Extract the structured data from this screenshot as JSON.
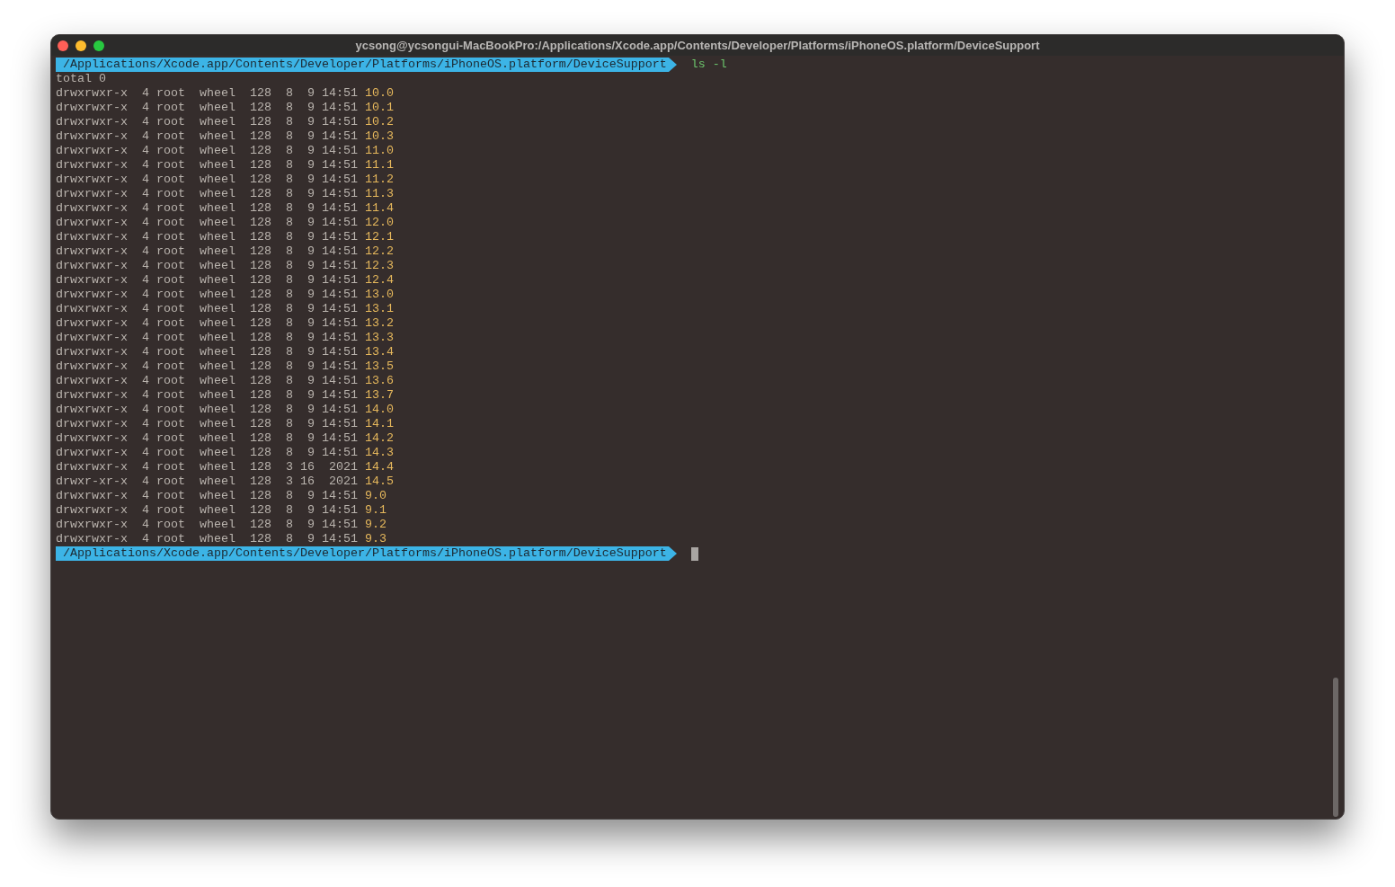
{
  "window": {
    "title": "ycsong@ycsongui-MacBookPro:/Applications/Xcode.app/Contents/Developer/Platforms/iPhoneOS.platform/DeviceSupport"
  },
  "terminal": {
    "lines": [
      {
        "kind": "prompt",
        "path": "/Applications/Xcode.app/Contents/Developer/Platforms/iPhoneOS.platform/DeviceSupport",
        "command": "ls -l"
      },
      {
        "kind": "text",
        "text": "total 0"
      },
      {
        "kind": "entry",
        "info": "drwxrwxr-x  4 root  wheel  128  8  9 14:51",
        "name": "10.0"
      },
      {
        "kind": "entry",
        "info": "drwxrwxr-x  4 root  wheel  128  8  9 14:51",
        "name": "10.1"
      },
      {
        "kind": "entry",
        "info": "drwxrwxr-x  4 root  wheel  128  8  9 14:51",
        "name": "10.2"
      },
      {
        "kind": "entry",
        "info": "drwxrwxr-x  4 root  wheel  128  8  9 14:51",
        "name": "10.3"
      },
      {
        "kind": "entry",
        "info": "drwxrwxr-x  4 root  wheel  128  8  9 14:51",
        "name": "11.0"
      },
      {
        "kind": "entry",
        "info": "drwxrwxr-x  4 root  wheel  128  8  9 14:51",
        "name": "11.1"
      },
      {
        "kind": "entry",
        "info": "drwxrwxr-x  4 root  wheel  128  8  9 14:51",
        "name": "11.2"
      },
      {
        "kind": "entry",
        "info": "drwxrwxr-x  4 root  wheel  128  8  9 14:51",
        "name": "11.3"
      },
      {
        "kind": "entry",
        "info": "drwxrwxr-x  4 root  wheel  128  8  9 14:51",
        "name": "11.4"
      },
      {
        "kind": "entry",
        "info": "drwxrwxr-x  4 root  wheel  128  8  9 14:51",
        "name": "12.0"
      },
      {
        "kind": "entry",
        "info": "drwxrwxr-x  4 root  wheel  128  8  9 14:51",
        "name": "12.1"
      },
      {
        "kind": "entry",
        "info": "drwxrwxr-x  4 root  wheel  128  8  9 14:51",
        "name": "12.2"
      },
      {
        "kind": "entry",
        "info": "drwxrwxr-x  4 root  wheel  128  8  9 14:51",
        "name": "12.3"
      },
      {
        "kind": "entry",
        "info": "drwxrwxr-x  4 root  wheel  128  8  9 14:51",
        "name": "12.4"
      },
      {
        "kind": "entry",
        "info": "drwxrwxr-x  4 root  wheel  128  8  9 14:51",
        "name": "13.0"
      },
      {
        "kind": "entry",
        "info": "drwxrwxr-x  4 root  wheel  128  8  9 14:51",
        "name": "13.1"
      },
      {
        "kind": "entry",
        "info": "drwxrwxr-x  4 root  wheel  128  8  9 14:51",
        "name": "13.2"
      },
      {
        "kind": "entry",
        "info": "drwxrwxr-x  4 root  wheel  128  8  9 14:51",
        "name": "13.3"
      },
      {
        "kind": "entry",
        "info": "drwxrwxr-x  4 root  wheel  128  8  9 14:51",
        "name": "13.4"
      },
      {
        "kind": "entry",
        "info": "drwxrwxr-x  4 root  wheel  128  8  9 14:51",
        "name": "13.5"
      },
      {
        "kind": "entry",
        "info": "drwxrwxr-x  4 root  wheel  128  8  9 14:51",
        "name": "13.6"
      },
      {
        "kind": "entry",
        "info": "drwxrwxr-x  4 root  wheel  128  8  9 14:51",
        "name": "13.7"
      },
      {
        "kind": "entry",
        "info": "drwxrwxr-x  4 root  wheel  128  8  9 14:51",
        "name": "14.0"
      },
      {
        "kind": "entry",
        "info": "drwxrwxr-x  4 root  wheel  128  8  9 14:51",
        "name": "14.1"
      },
      {
        "kind": "entry",
        "info": "drwxrwxr-x  4 root  wheel  128  8  9 14:51",
        "name": "14.2"
      },
      {
        "kind": "entry",
        "info": "drwxrwxr-x  4 root  wheel  128  8  9 14:51",
        "name": "14.3"
      },
      {
        "kind": "entry",
        "info": "drwxrwxr-x  4 root  wheel  128  3 16  2021",
        "name": "14.4"
      },
      {
        "kind": "entry",
        "info": "drwxr-xr-x  4 root  wheel  128  3 16  2021",
        "name": "14.5"
      },
      {
        "kind": "entry",
        "info": "drwxrwxr-x  4 root  wheel  128  8  9 14:51",
        "name": "9.0"
      },
      {
        "kind": "entry",
        "info": "drwxrwxr-x  4 root  wheel  128  8  9 14:51",
        "name": "9.1"
      },
      {
        "kind": "entry",
        "info": "drwxrwxr-x  4 root  wheel  128  8  9 14:51",
        "name": "9.2"
      },
      {
        "kind": "entry",
        "info": "drwxrwxr-x  4 root  wheel  128  8  9 14:51",
        "name": "9.3"
      },
      {
        "kind": "prompt",
        "path": "/Applications/Xcode.app/Contents/Developer/Platforms/iPhoneOS.platform/DeviceSupport",
        "cursor": true
      }
    ]
  }
}
